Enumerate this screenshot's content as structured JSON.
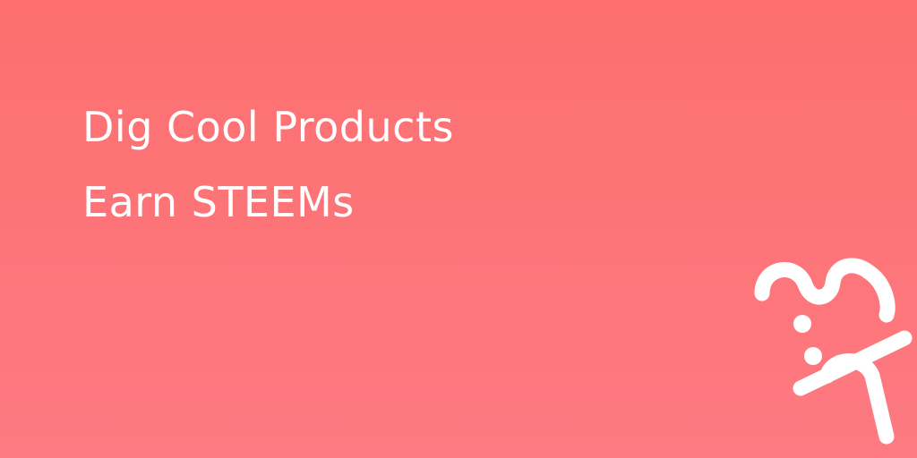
{
  "headline": {
    "line1": "Dig Cool Products",
    "line2": "Earn STEEMs"
  },
  "colors": {
    "gradient_top": "#fd6f6f",
    "gradient_bottom": "#fd7a82",
    "text": "#ffffff"
  },
  "logo": {
    "icon": "steemhunt-sh-logo-icon"
  }
}
